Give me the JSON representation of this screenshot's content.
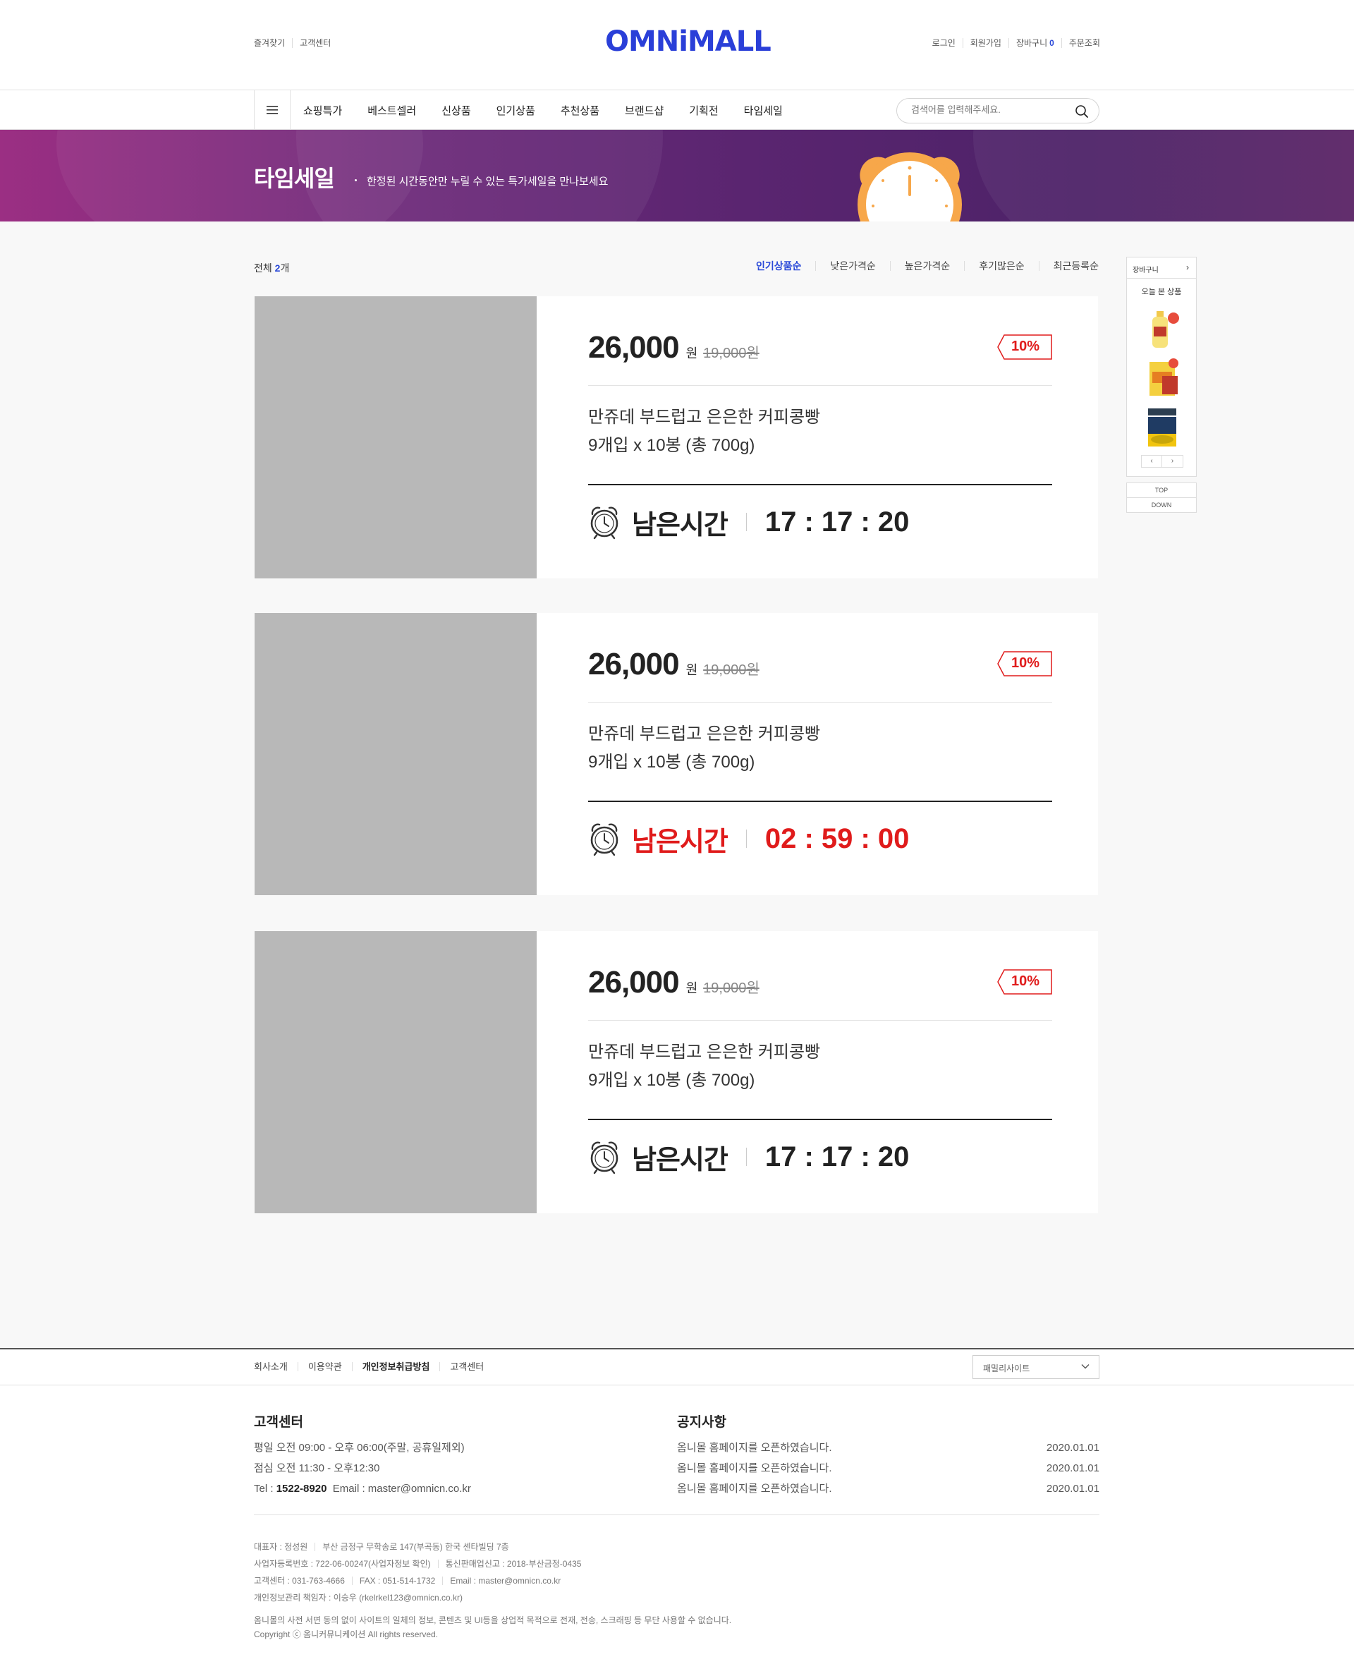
{
  "header": {
    "util_left": [
      "즐겨찾기",
      "고객센터"
    ],
    "logo": "OMNiMALL",
    "util_right": {
      "login": "로그인",
      "join": "회원가입",
      "cart": "장바구니",
      "cart_count": "0",
      "order": "주문조회"
    },
    "menu": [
      "쇼핑특가",
      "베스트셀러",
      "신상품",
      "인기상품",
      "추천상품",
      "브랜드샵",
      "기획전",
      "타임세일"
    ],
    "search_placeholder": "검색어를 입력해주세요.",
    "icons": {
      "menu": "hamburger-icon",
      "search": "search-icon"
    },
    "colors": {
      "brand": "#2a3fd8"
    }
  },
  "banner": {
    "title": "타임세일",
    "description": "한정된 시간동안만 누릴 수 있는 특가세일을 만나보세요",
    "colors": {
      "start": "#9b2f83",
      "end": "#4d2268",
      "clock": "#f7a74a"
    }
  },
  "list": {
    "total_prefix": "전체",
    "total_count": "2",
    "total_suffix": "개",
    "sort": [
      "인기상품순",
      "낮은가격순",
      "높은가격순",
      "후기많은순",
      "최근등록순"
    ],
    "sort_active": "인기상품순",
    "items": [
      {
        "price": "26,000",
        "unit": "원",
        "original_price": "19,000원",
        "discount": "10%",
        "name_line1": "만쥬데 부드럽고 은은한 커피콩빵",
        "name_line2": "9개입 x 10봉 (총 700g)",
        "timer_label": "남은시간",
        "timer_value": "17 : 17 : 20",
        "urgent": false
      },
      {
        "price": "26,000",
        "unit": "원",
        "original_price": "19,000원",
        "discount": "10%",
        "name_line1": "만쥬데 부드럽고 은은한 커피콩빵",
        "name_line2": "9개입 x 10봉 (총 700g)",
        "timer_label": "남은시간",
        "timer_value": "02 : 59 : 00",
        "urgent": true
      },
      {
        "price": "26,000",
        "unit": "원",
        "original_price": "19,000원",
        "discount": "10%",
        "name_line1": "만쥬데 부드럽고 은은한 커피콩빵",
        "name_line2": "9개입 x 10봉 (총 700g)",
        "timer_label": "남은시간",
        "timer_value": "17 : 17 : 20",
        "urgent": false
      }
    ],
    "colors": {
      "accent": "#2a49d8",
      "sale": "#e01b1b"
    }
  },
  "quick": {
    "cart": "장바구니",
    "recent_title": "오늘 본 상품",
    "prev": "‹",
    "next": "›",
    "top": "TOP",
    "down": "DOWN"
  },
  "footer": {
    "nav": [
      "회사소개",
      "이용약관",
      "개인정보취급방침",
      "고객센터"
    ],
    "nav_bold": "개인정보취급방침",
    "family_site": "패밀리사이트",
    "cs": {
      "title": "고객센터",
      "line1": "평일 오전 09:00 - 오후 06:00(주말, 공휴일제외)",
      "line2": "점심 오전 11:30 - 오후12:30",
      "tel_label": "Tel : ",
      "tel": "1522-8920",
      "email_label": "Email : master@omnicn.co.kr"
    },
    "notice": {
      "title": "공지사항",
      "rows": [
        {
          "text": "옴니몰 홈페이지를 오픈하였습니다.",
          "date": "2020.01.01"
        },
        {
          "text": "옴니몰 홈페이지를 오픈하였습니다.",
          "date": "2020.01.01"
        },
        {
          "text": "옴니몰 홈페이지를 오픈하였습니다.",
          "date": "2020.01.01"
        }
      ]
    },
    "info": {
      "ceo": "대표자 : 정성원",
      "address": "부산 금정구 무학송로 147(부곡동) 한국 센타빌딩 7층",
      "biz_no": "사업자등록번호 : 722-06-00247(사업자정보 확인)",
      "mail_order": "통신판매업신고 : 2018-부산금정-0435",
      "cs_tel": "고객센터 : 031-763-4666",
      "fax": "FAX : 051-514-1732",
      "email": "Email : master@omnicn.co.kr",
      "privacy": "개인정보관리 책임자 : 이승우 (rkelrkel123@omnicn.co.kr)"
    },
    "notice_text": "옴니몰의 사전 서면 동의 없이 사이트의 일체의 정보, 콘텐츠 및 UI등을 상업적 목적으로 전재, 전송, 스크래핑 등 무단 사용할 수 없습니다.",
    "copyright": "Copyright ⓒ 옴니커뮤니케이션 All rights reserved."
  }
}
